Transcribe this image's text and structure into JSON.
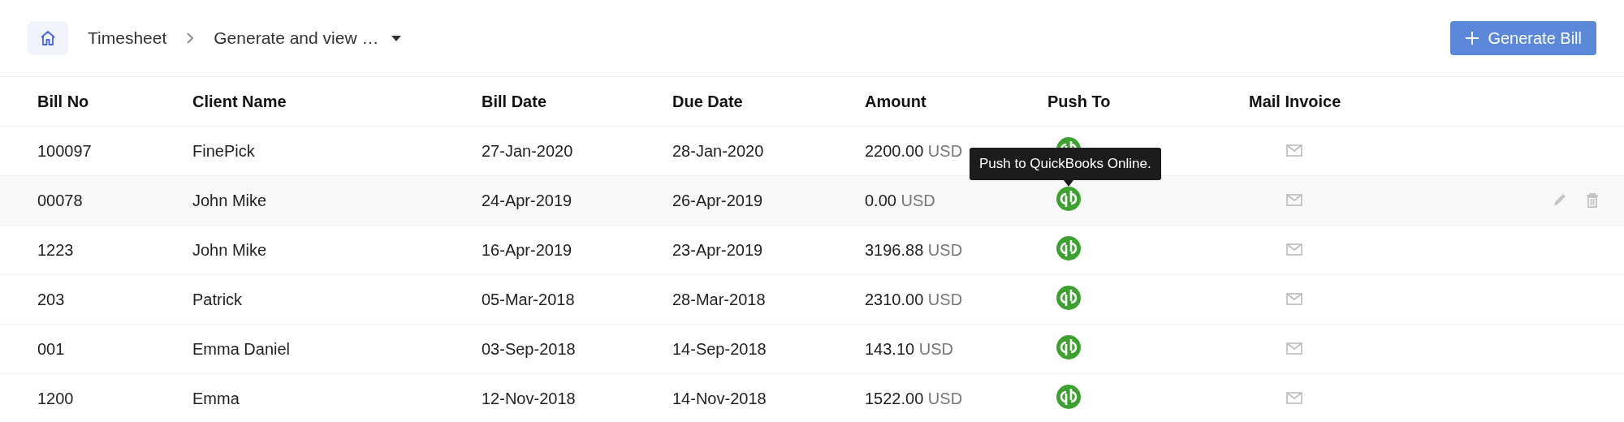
{
  "breadcrumb": [
    {
      "label": "Timesheet"
    },
    {
      "label": "Generate and view …",
      "dropdown": true
    }
  ],
  "primary_button": {
    "label": "Generate Bill"
  },
  "table": {
    "columns": [
      "Bill No",
      "Client Name",
      "Bill Date",
      "Due Date",
      "Amount",
      "Push To",
      "Mail Invoice"
    ],
    "rows": [
      {
        "bill_no": "100097",
        "client": "FinePick",
        "bill_date": "27-Jan-2020",
        "due_date": "28-Jan-2020",
        "amount": "2200.00",
        "currency": "USD",
        "hovered": false
      },
      {
        "bill_no": "00078",
        "client": "John Mike",
        "bill_date": "24-Apr-2019",
        "due_date": "26-Apr-2019",
        "amount": "0.00",
        "currency": "USD",
        "hovered": true,
        "tooltip": "Push to QuickBooks Online."
      },
      {
        "bill_no": "1223",
        "client": "John Mike",
        "bill_date": "16-Apr-2019",
        "due_date": "23-Apr-2019",
        "amount": "3196.88",
        "currency": "USD",
        "hovered": false
      },
      {
        "bill_no": "203",
        "client": "Patrick",
        "bill_date": "05-Mar-2018",
        "due_date": "28-Mar-2018",
        "amount": "2310.00",
        "currency": "USD",
        "hovered": false
      },
      {
        "bill_no": "001",
        "client": "Emma Daniel",
        "bill_date": "03-Sep-2018",
        "due_date": "14-Sep-2018",
        "amount": "143.10",
        "currency": "USD",
        "hovered": false
      },
      {
        "bill_no": "1200",
        "client": "Emma",
        "bill_date": "12-Nov-2018",
        "due_date": "14-Nov-2018",
        "amount": "1522.00",
        "currency": "USD",
        "hovered": false
      }
    ]
  }
}
